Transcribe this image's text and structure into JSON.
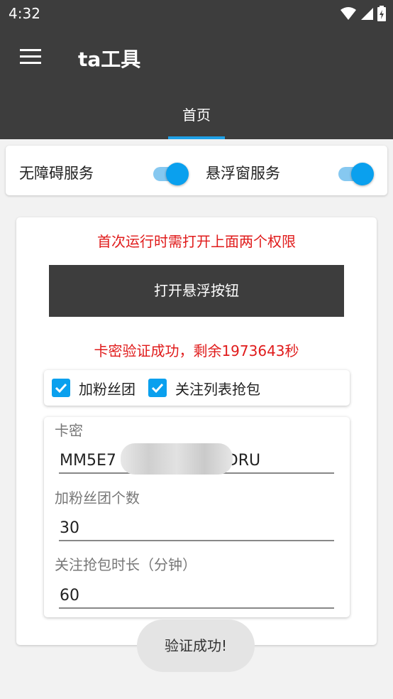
{
  "status": {
    "time": "4:32"
  },
  "app": {
    "title": "ta工具"
  },
  "tabs": [
    {
      "label": "首页",
      "active": true
    }
  ],
  "permissions": {
    "accessibility": {
      "label": "无障碍服务",
      "enabled": true
    },
    "overlay": {
      "label": "悬浮窗服务",
      "enabled": true
    }
  },
  "main": {
    "notice": "首次运行时需打开上面两个权限",
    "open_button": "打开悬浮按钮",
    "verify_message": "卡密验证成功，剩余1973643秒",
    "checkboxes": [
      {
        "label": "加粉丝团",
        "checked": true
      },
      {
        "label": "关注列表抢包",
        "checked": true
      }
    ],
    "fields": {
      "card_key": {
        "label": "卡密",
        "value": "MM5E7                    ZDRU"
      },
      "fan_count": {
        "label": "加粉丝团个数",
        "value": "30"
      },
      "duration": {
        "label": "关注抢包时长（分钟）",
        "value": "60"
      }
    }
  },
  "toast": {
    "text": "验证成功!"
  },
  "colors": {
    "bar": "#3d3d3d",
    "accent": "#0aa0ee",
    "alert": "#e01b1b"
  }
}
